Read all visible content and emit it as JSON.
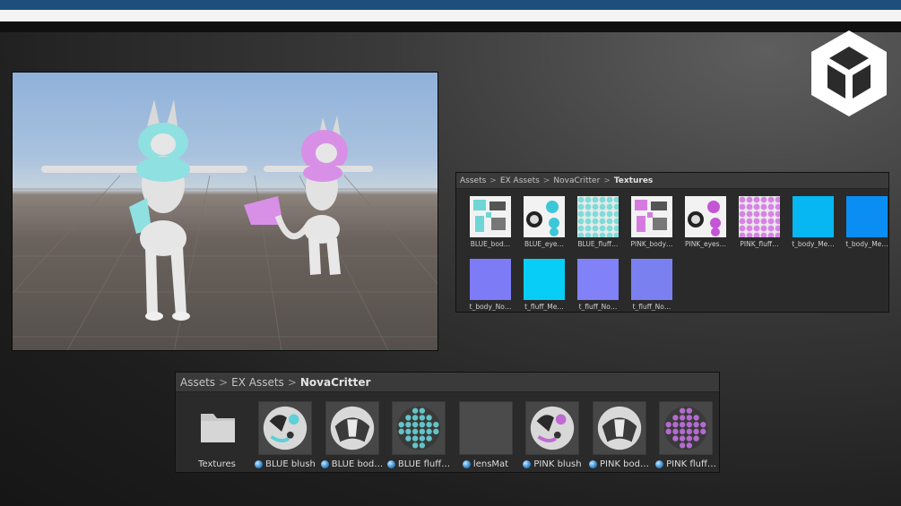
{
  "texture_panel": {
    "breadcrumb": [
      "Assets",
      "EX Assets",
      "NovaCritter",
      "Textures"
    ],
    "items": [
      {
        "label": "BLUE_bod…",
        "kind": "atlas",
        "color": "#6fd6d6"
      },
      {
        "label": "BLUE_eye…",
        "kind": "eyes",
        "color": "#3cc7d9"
      },
      {
        "label": "BLUE_fluff…",
        "kind": "fluff",
        "color": "#7fdcd8"
      },
      {
        "label": "PINK_body…",
        "kind": "atlas",
        "color": "#d57be0"
      },
      {
        "label": "PINK_eyes…",
        "kind": "eyes",
        "color": "#c456d6"
      },
      {
        "label": "PINK_fluff…",
        "kind": "fluff",
        "color": "#d783e6"
      },
      {
        "label": "t_body_Me…",
        "kind": "solid",
        "color": "#06b7f2"
      },
      {
        "label": "t_body_Me…",
        "kind": "solid",
        "color": "#0a8ef4"
      },
      {
        "label": "t_body_No…",
        "kind": "normal",
        "color": "#7d7bf5"
      },
      {
        "label": "t_fluff_Me…",
        "kind": "solid",
        "color": "#07cdf7"
      },
      {
        "label": "t_fluff_No…",
        "kind": "normal",
        "color": "#8181f8"
      },
      {
        "label": "t_fluff_No…",
        "kind": "normal",
        "color": "#7b80f1"
      }
    ]
  },
  "material_panel": {
    "breadcrumb": [
      "Assets",
      "EX Assets",
      "NovaCritter"
    ],
    "folder": {
      "label": "Textures"
    },
    "items": [
      {
        "label": "BLUE blush",
        "kind": "face",
        "accent": "#5fd0d6"
      },
      {
        "label": "BLUE bod…",
        "kind": "body",
        "accent": "#e6e6e6"
      },
      {
        "label": "BLUE fluff…",
        "kind": "fluff",
        "accent": "#62c4c8"
      },
      {
        "label": "lensMat",
        "kind": "empty",
        "accent": "#4b4b4b"
      },
      {
        "label": "PINK blush",
        "kind": "face",
        "accent": "#c06ad3"
      },
      {
        "label": "PINK bod…",
        "kind": "body",
        "accent": "#e6e6e6"
      },
      {
        "label": "PINK fluff…",
        "kind": "fluff",
        "accent": "#b46bd0"
      }
    ]
  },
  "colors": {
    "blue_accent": "#1d4f7a",
    "panel_bg": "#2a2a2a",
    "cyan_character": "#8fe0e0",
    "pink_character": "#d890e6"
  }
}
